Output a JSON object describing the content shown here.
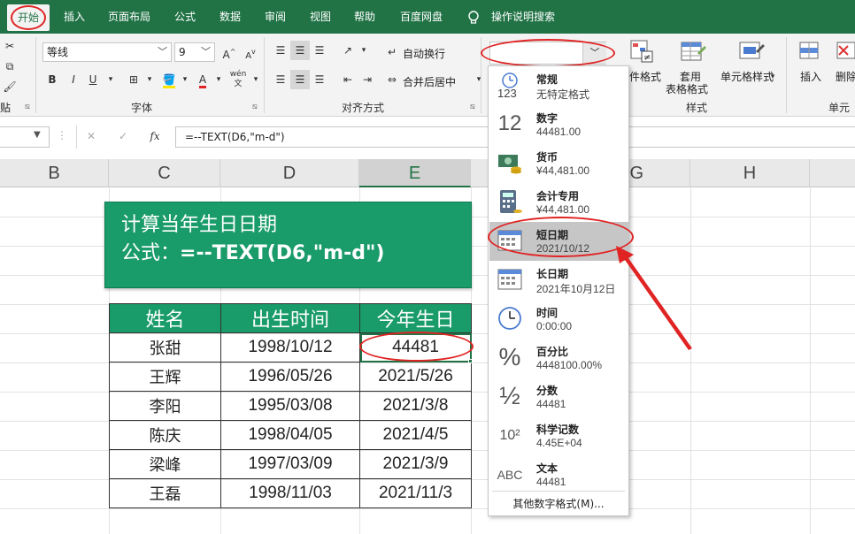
{
  "ribbon_tabs": [
    "开始",
    "插入",
    "页面布局",
    "公式",
    "数据",
    "审阅",
    "视图",
    "帮助",
    "百度网盘",
    "操作说明搜索"
  ],
  "font": {
    "name": "等线",
    "size": "9",
    "bold": "B",
    "italic": "I",
    "underline": "U",
    "grow": "A",
    "shrink": "A",
    "pinyin": "wén"
  },
  "alignment": {
    "wrap_text": "自动换行",
    "merge_center": "合并后居中"
  },
  "groups": {
    "font": "字体",
    "alignment": "对齐方式",
    "styles": "样式",
    "cells": "单元"
  },
  "styles": {
    "conditional": "件格式",
    "table_fmt_1": "套用",
    "table_fmt_2": "表格格式",
    "cell_styles": "单元格样式"
  },
  "cells": {
    "insert": "插入",
    "delete": "删除"
  },
  "formula_bar": {
    "fx": "fx",
    "formula": "=--TEXT(D6,\"m-d\")"
  },
  "columns": [
    "B",
    "C",
    "D",
    "E",
    "G",
    "H"
  ],
  "banner": {
    "line1": "计算当年生日日期",
    "line2_prefix": "公式：",
    "line2_formula": "=--TEXT(D6,\"m-d\")"
  },
  "table": {
    "headers": [
      "姓名",
      "出生时间",
      "今年生日"
    ],
    "rows": [
      [
        "张甜",
        "1998/10/12",
        "44481"
      ],
      [
        "王辉",
        "1996/05/26",
        "2021/5/26"
      ],
      [
        "李阳",
        "1995/03/08",
        "2021/3/8"
      ],
      [
        "陈庆",
        "1998/04/05",
        "2021/4/5"
      ],
      [
        "梁峰",
        "1997/03/09",
        "2021/3/9"
      ],
      [
        "王磊",
        "1998/11/03",
        "2021/11/3"
      ]
    ]
  },
  "number_format_menu": {
    "items": [
      {
        "title": "常规",
        "sub": "无特定格式",
        "icon": "123"
      },
      {
        "title": "数字",
        "sub": "44481.00",
        "icon": "12"
      },
      {
        "title": "货币",
        "sub": "¥44,481.00",
        "icon": "currency"
      },
      {
        "title": "会计专用",
        "sub": " ¥44,481.00",
        "icon": "calculator"
      },
      {
        "title": "短日期",
        "sub": "2021/10/12",
        "icon": "calendar"
      },
      {
        "title": "长日期",
        "sub": "2021年10月12日",
        "icon": "calendar"
      },
      {
        "title": "时间",
        "sub": "0:00:00",
        "icon": "clock"
      },
      {
        "title": "百分比",
        "sub": "4448100.00%",
        "icon": "%"
      },
      {
        "title": "分数",
        "sub": "44481",
        "icon": "½"
      },
      {
        "title": "科学记数",
        "sub": "4.45E+04",
        "icon": "10²"
      },
      {
        "title": "文本",
        "sub": "44481",
        "icon": "ABC"
      }
    ],
    "selected_index": 4,
    "more": "其他数字格式(M)..."
  },
  "colors": {
    "excel_green": "#217346",
    "banner_green": "#199b6a",
    "annotation_red": "#e02424"
  }
}
